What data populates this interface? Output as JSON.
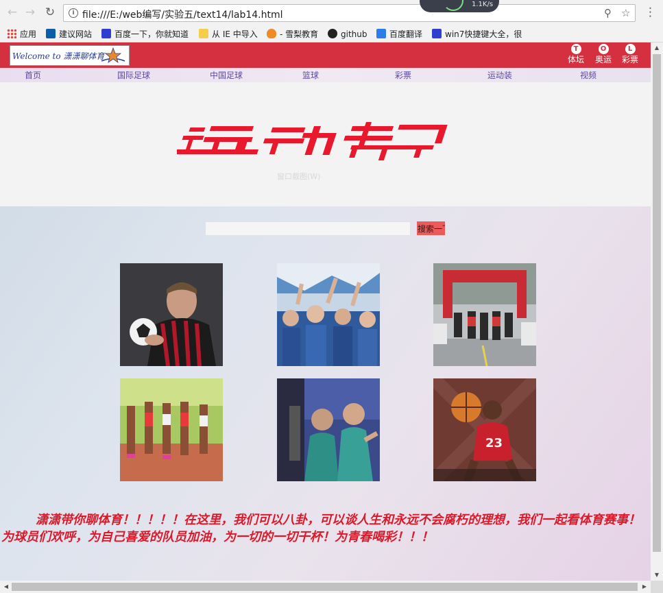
{
  "browser": {
    "url": "file:///E:/web编写/实验五/text14/lab14.html",
    "extension_speed": "1.1K/s",
    "bookmarks": [
      {
        "label": "应用",
        "icon": "apps-grid-icon"
      },
      {
        "label": "建议网站",
        "icon": "bing-icon"
      },
      {
        "label": "百度一下，你就知道",
        "icon": "baidu-paw-icon"
      },
      {
        "label": "从 IE 中导入",
        "icon": "folder-icon"
      },
      {
        "label": "- 雪梨教育",
        "icon": "flame-icon"
      },
      {
        "label": "github",
        "icon": "github-icon"
      },
      {
        "label": "百度翻译",
        "icon": "translate-icon"
      },
      {
        "label": "win7快捷键大全，很",
        "icon": "baidu-paw-icon"
      }
    ]
  },
  "header": {
    "logo_text": "Welcome to 潇潇聊体育",
    "top_links": [
      {
        "letter": "T",
        "label": "体坛"
      },
      {
        "letter": "O",
        "label": "奥运"
      },
      {
        "letter": "L",
        "label": "彩票"
      }
    ]
  },
  "nav": {
    "items": [
      "首页",
      "国际足球",
      "中国足球",
      "篮球",
      "彩票",
      "运动装",
      "视频"
    ]
  },
  "banner": {
    "logo_text": "运动帮",
    "hint": "窗口截图(W)"
  },
  "search": {
    "value": "",
    "button_label": "搜索一下"
  },
  "photos": [
    {
      "name": "footballer-photo",
      "icon": "soccer-player-icon"
    },
    {
      "name": "fans-photo",
      "icon": "crowd-icon"
    },
    {
      "name": "cyclists-photo",
      "icon": "bicycle-race-icon"
    },
    {
      "name": "runners-photo",
      "icon": "track-runners-icon"
    },
    {
      "name": "team-celebration-photo",
      "icon": "team-icon"
    },
    {
      "name": "basketball-player-photo",
      "icon": "basketball-icon"
    }
  ],
  "footer_text": "潇潇带你聊体育！！！！！在这里，我们可以八卦，可以谈人生和永远不会腐朽的理想，我们一起看体育赛事！为球员们欢呼，为自己喜爱的队员加油，为一切的一切干杯！为青春喝彩！！！",
  "colors": {
    "header_red": "#d4303f",
    "nav_text": "#5b4aa0",
    "footer_text_red": "#d91a2a",
    "search_button": "#ec5a5a"
  }
}
